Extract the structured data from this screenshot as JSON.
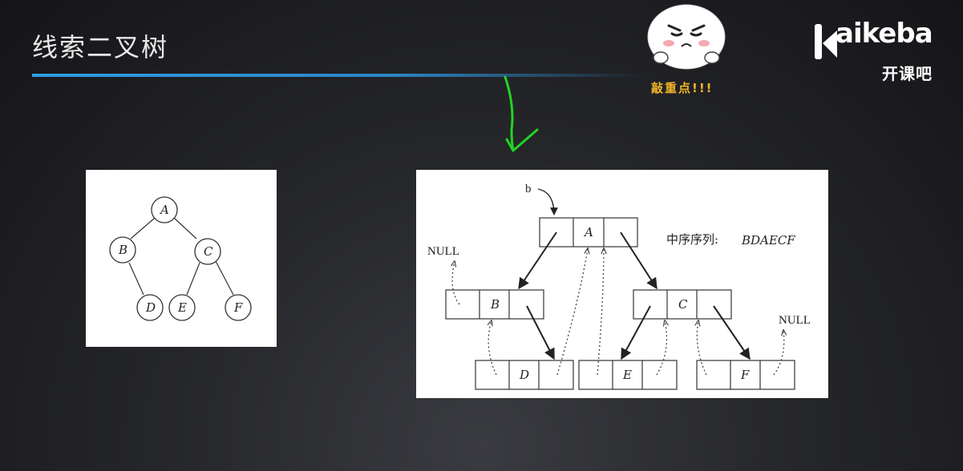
{
  "slide": {
    "title": "线索二叉树",
    "sticker_caption": "敲重点!!!"
  },
  "brand": {
    "logo_text": "aikeba",
    "logo_sub": "开课吧"
  },
  "tree": {
    "nodes": [
      "A",
      "B",
      "C",
      "D",
      "E",
      "F"
    ]
  },
  "threaded": {
    "pointer_label": "b",
    "inorder_label": "中序序列:",
    "inorder_value": "BDAECF",
    "null_left": "NULL",
    "null_right": "NULL",
    "cells": [
      "A",
      "B",
      "C",
      "D",
      "E",
      "F"
    ]
  },
  "colors": {
    "accent": "#2f9ee8",
    "arrow": "#22d422",
    "sticker_text": "#f0b52a"
  }
}
